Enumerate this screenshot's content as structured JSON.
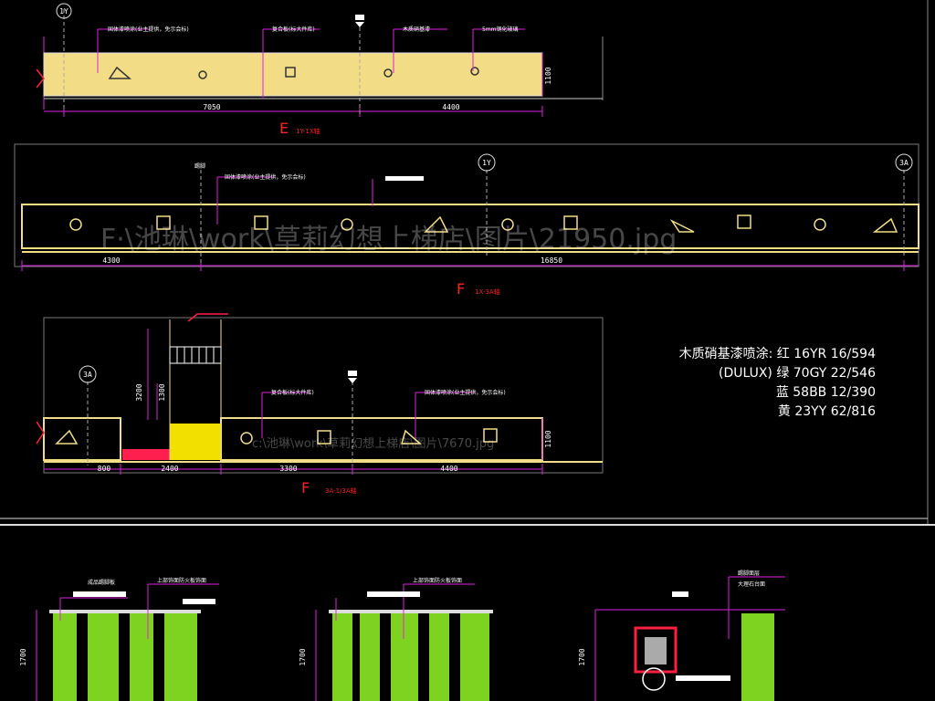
{
  "drawing": {
    "elevation_e": {
      "title_letter": "E",
      "title_sub": "1Y-1X轴",
      "axis_tag": "1Y",
      "dims": [
        "7050",
        "4400"
      ],
      "height_dim": "1100",
      "labels": [
        "固体漆喷涂(业主提供，免示会标)",
        "复合板(标大件库)",
        "木质硝基漆",
        "5mm钢化玻璃"
      ]
    },
    "elevation_f1": {
      "title_letter": "F",
      "title_sub": "1X-3A轴",
      "axis_tags": [
        "1Y",
        "3A"
      ],
      "dims": [
        "4300",
        "16850"
      ],
      "labels": [
        "固体漆喷涂(业主提供，免示会标)",
        "踢脚"
      ]
    },
    "elevation_f2": {
      "title_letter": "F",
      "title_sub": "3A-1/3A轴",
      "axis_tag": "3A",
      "dims": [
        "800",
        "2400",
        "3300",
        "4400"
      ],
      "height_dims": [
        "1100",
        "1300",
        "3200"
      ],
      "labels": [
        "复合板(标大件库)",
        "固体漆喷涂(业主提供，免示会标)"
      ]
    },
    "watermarks": [
      "F·\\池琳\\work\\草莉幻想上梯店\\图片\\21950.jpg",
      "c:\\池琳\\work\\草莉幻想上梯店\\图片\\7670.jpg"
    ],
    "paint_note": {
      "lines": [
        "木质硝基漆喷涂: 红 16YR 16/594",
        "(DULUX) 绿 70GY 22/546",
        "蓝 58BB 12/390",
        "黄 23YY 62/816"
      ]
    },
    "bottom_details": {
      "height_dim": "1700",
      "labels": [
        "成品踢脚板",
        "上部饰面防火板饰面",
        "踢脚面层",
        "大理石台面"
      ]
    }
  },
  "colors": {
    "yellow_panel": "#f2dd86",
    "red_accent": "#ff1f4f",
    "magenta_line": "#e020e0",
    "green_panel": "#7ed321"
  }
}
